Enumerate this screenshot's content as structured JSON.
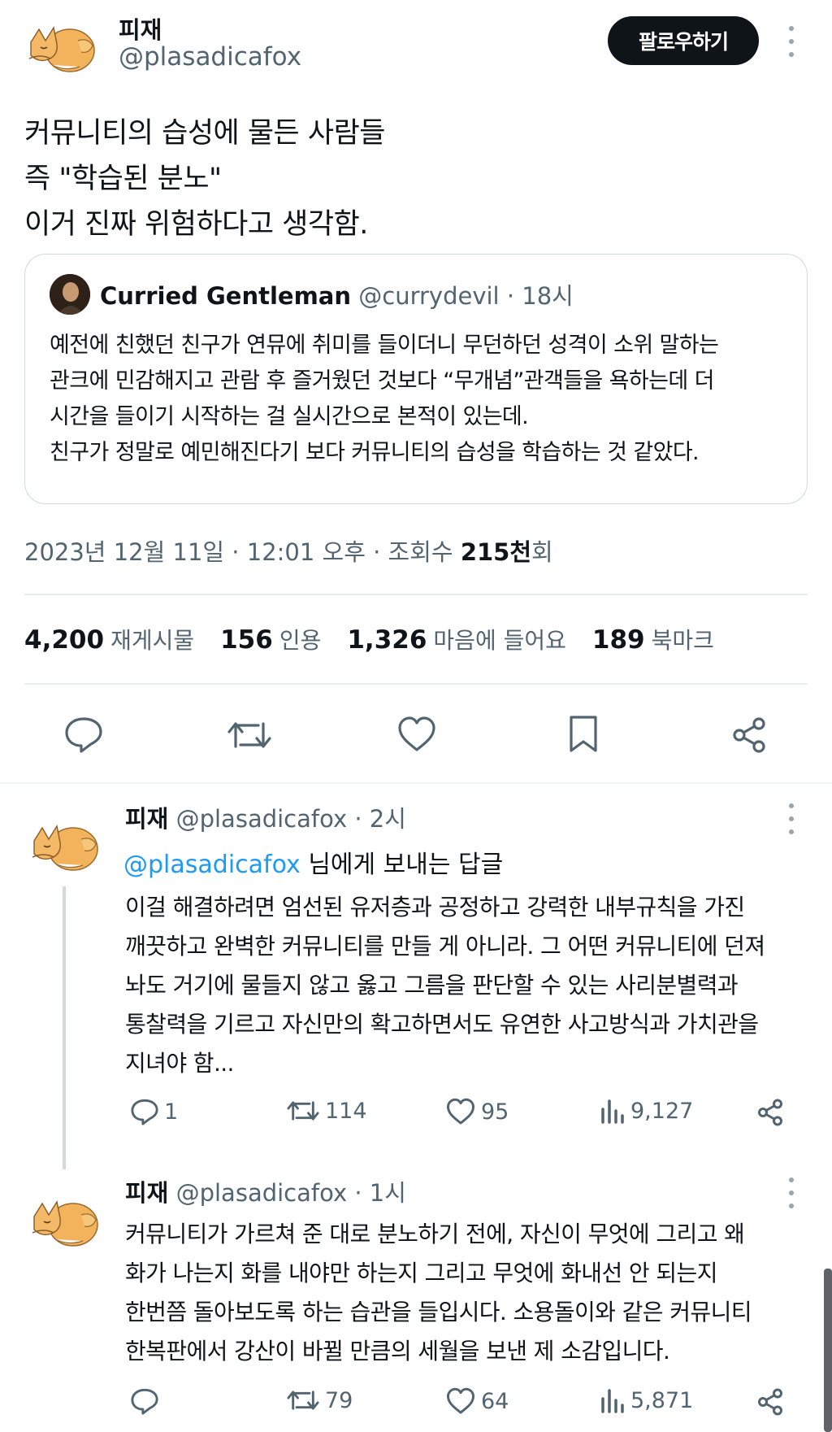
{
  "author": {
    "name": "피재",
    "handle": "@plasadicafox",
    "follow_label": "팔로우하기"
  },
  "tweet": {
    "lines": [
      "커뮤니티의 습성에 물든 사람들",
      "즉 \"학습된 분노\"",
      "이거 진짜 위험하다고 생각함."
    ]
  },
  "quote": {
    "name": "Curried Gentleman",
    "handle": "@currydevil",
    "time": "· 18시",
    "lines": [
      "예전에 친했던 친구가 연뮤에 취미를 들이더니 무던하던 성격이 소위 말하는",
      "관크에 민감해지고 관람 후 즐거웠던 것보다 “무개념”관객들을 욕하는데 더",
      "시간을 들이기 시작하는 걸 실시간으로 본적이 있는데.",
      "친구가 정말로 예민해진다기 보다 커뮤니티의 습성을 학습하는 것 같았다."
    ]
  },
  "meta": {
    "date_time": "2023년 12월 11일 · 12:01 오후 · 조회수 ",
    "views": "215천",
    "views_suffix": "회"
  },
  "stats": [
    {
      "num": "4,200",
      "label": "재게시물"
    },
    {
      "num": "156",
      "label": "인용"
    },
    {
      "num": "1,326",
      "label": "마음에 들어요"
    },
    {
      "num": "189",
      "label": "북마크"
    }
  ],
  "replies": [
    {
      "name": "피재",
      "handle": "@plasadicafox",
      "time": "· 2시",
      "reply_to_handle": "@plasadicafox",
      "reply_to_suffix": " 님에게 보내는 답글",
      "lines": [
        "이걸 해결하려면 엄선된 유저층과 공정하고 강력한 내부규칙을 가진",
        "깨끗하고 완벽한 커뮤니티를 만들 게 아니라. 그 어떤 커뮤니티에 던져",
        "놔도 거기에 물들지 않고 옳고 그름을 판단할 수 있는 사리분별력과",
        "통찰력을 기르고 자신만의 확고하면서도 유연한 사고방식과 가치관을",
        "지녀야 함..."
      ],
      "replies_count": "1",
      "reposts": "114",
      "likes": "95",
      "views": "9,127"
    },
    {
      "name": "피재",
      "handle": "@plasadicafox",
      "time": "· 1시",
      "lines": [
        "커뮤니티가 가르쳐 준 대로 분노하기 전에, 자신이 무엇에 그리고 왜",
        "화가 나는지 화를 내야만 하는지 그리고 무엇에 화내선 안 되는지",
        "한번쯤 돌아보도록 하는 습관을 들입시다. 소용돌이와 같은 커뮤니티",
        "한복판에서 강산이 바뀔 만큼의 세월을 보낸 제 소감입니다."
      ],
      "replies_count": "",
      "reposts": "79",
      "likes": "64",
      "views": "5,871"
    }
  ],
  "colors": {
    "text": "#0f1419",
    "muted": "#536471",
    "link": "#1d9bf0",
    "border": "#cfd9de"
  }
}
